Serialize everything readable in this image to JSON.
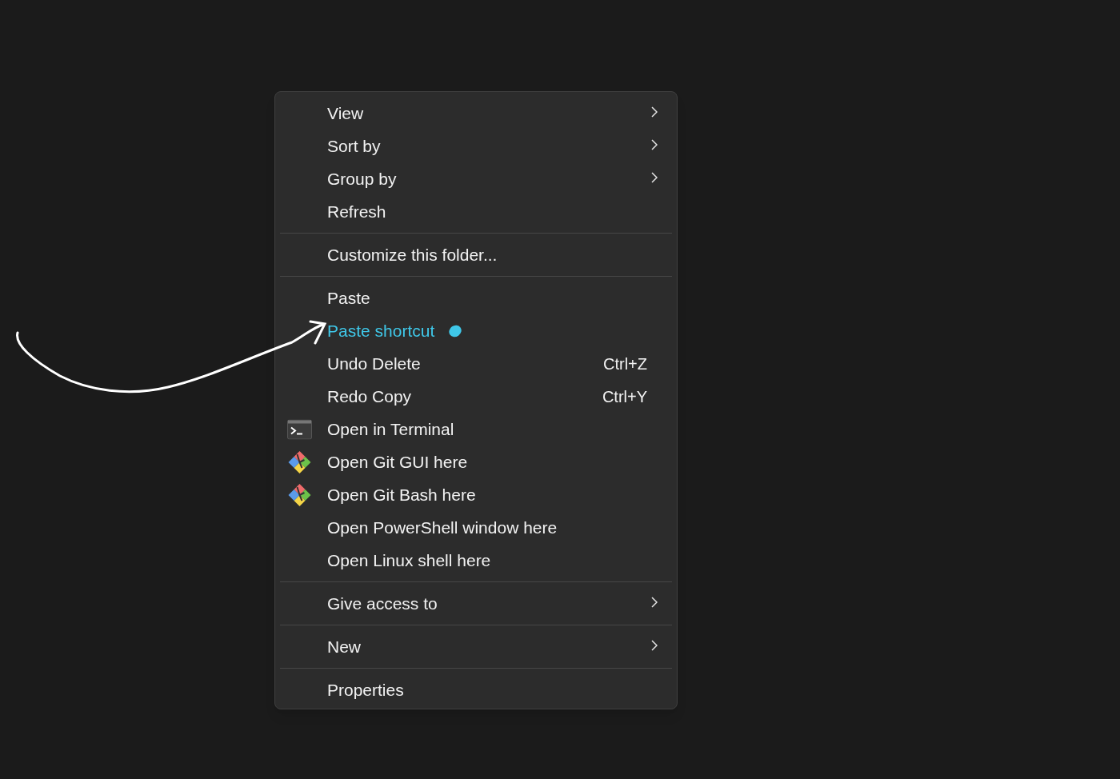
{
  "context_menu": {
    "groups": [
      {
        "items": [
          {
            "label": "View",
            "submenu": true
          },
          {
            "label": "Sort by",
            "submenu": true
          },
          {
            "label": "Group by",
            "submenu": true
          },
          {
            "label": "Refresh",
            "submenu": false
          }
        ]
      },
      {
        "items": [
          {
            "label": "Customize this folder...",
            "submenu": false
          }
        ]
      },
      {
        "items": [
          {
            "label": "Paste",
            "submenu": false
          },
          {
            "label": "Paste shortcut",
            "submenu": false,
            "highlighted": true
          },
          {
            "label": "Undo Delete",
            "submenu": false,
            "shortcut": "Ctrl+Z"
          },
          {
            "label": "Redo Copy",
            "submenu": false,
            "shortcut": "Ctrl+Y"
          },
          {
            "label": "Open in Terminal",
            "submenu": false,
            "kind": "terminal"
          },
          {
            "label": "Open Git GUI here",
            "submenu": false,
            "kind": "git"
          },
          {
            "label": "Open Git Bash here",
            "submenu": false,
            "kind": "git"
          },
          {
            "label": "Open PowerShell window here",
            "submenu": false
          },
          {
            "label": "Open Linux shell here",
            "submenu": false
          }
        ]
      },
      {
        "items": [
          {
            "label": "Give access to",
            "submenu": true
          }
        ]
      },
      {
        "items": [
          {
            "label": "New",
            "submenu": true
          }
        ]
      },
      {
        "items": [
          {
            "label": "Properties",
            "submenu": false
          }
        ]
      }
    ]
  }
}
